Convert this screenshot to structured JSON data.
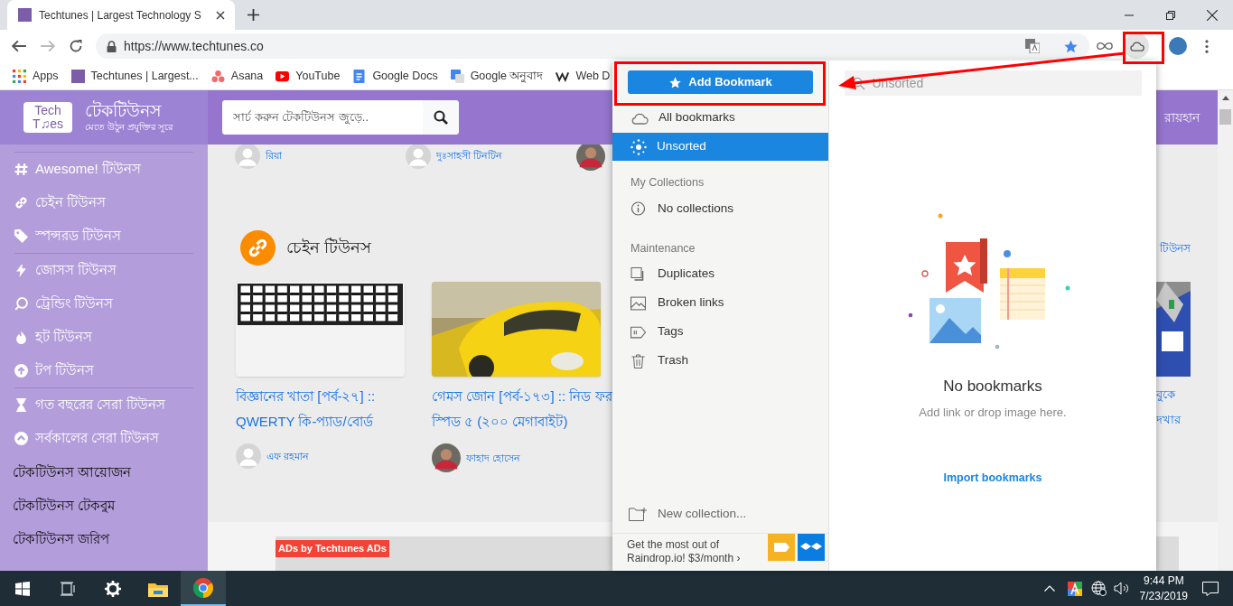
{
  "browser": {
    "tab": {
      "title": "Techtunes | Largest Technology S"
    },
    "url": "https://www.techtunes.co",
    "bookmarks": [
      {
        "label": "Apps"
      },
      {
        "label": "Techtunes | Largest..."
      },
      {
        "label": "Asana"
      },
      {
        "label": "YouTube"
      },
      {
        "label": "Google Docs"
      },
      {
        "label": "Google অনুবাদ"
      },
      {
        "label": "Web D"
      }
    ]
  },
  "site": {
    "logo": {
      "line1": "Tech",
      "line2": "T♫es"
    },
    "brand": "টেকটিউনস",
    "tagline": "মেতে উঠুন প্রযুক্তির সুরে",
    "search": {
      "placeholder": "সার্চ করুন টেকটিউনস জুড়ে.."
    },
    "user": "রায়হান",
    "sidebar": {
      "groups": [
        {
          "divided": true,
          "items": [
            {
              "label": "Awesome! টিউনস",
              "kind": "icon"
            },
            {
              "label": "চেইন টিউনস",
              "kind": "icon"
            },
            {
              "label": "স্পন্সরড টিউনস",
              "kind": "icon"
            }
          ]
        },
        {
          "divided": true,
          "items": [
            {
              "label": "জোসস টিউনস",
              "kind": "icon"
            },
            {
              "label": "ট্রেন্ডিং টিউনস",
              "kind": "icon"
            },
            {
              "label": "হট টিউনস",
              "kind": "icon"
            },
            {
              "label": "টপ টিউনস",
              "kind": "icon"
            }
          ]
        },
        {
          "divided": true,
          "items": [
            {
              "label": "গত বছরের সেরা টিউনস",
              "kind": "icon"
            },
            {
              "label": "সর্বকালের সেরা টিউনস",
              "kind": "icon"
            }
          ]
        },
        {
          "divided": false,
          "items": [
            {
              "label": "টেকটিউনস আয়োজন",
              "kind": "text"
            },
            {
              "label": "টেকটিউনস টেকবুম",
              "kind": "text"
            },
            {
              "label": "টেকটিউনস জরিপ",
              "kind": "text"
            }
          ]
        }
      ]
    },
    "authors": [
      {
        "name": "রিয়া",
        "kind": "silhouette"
      },
      {
        "name": "দুঃসাহসী টিনটিন",
        "kind": "silhouette"
      },
      {
        "kind": "picture"
      }
    ],
    "section": {
      "title": "চেইন টিউনস",
      "more": "টিউনস"
    },
    "cards": [
      {
        "title": "বিজ্ঞানের খাতা [পর্ব-২৭] :: QWERTY কি-প্যাড/বোর্ড",
        "author": "এফ রহমান",
        "kind": "silhouette"
      },
      {
        "title": "গেমস জোন [পর্ব-১৭৩] :: নিড ফর স্পিড ৫ (২০০ মেগাবাইট)",
        "author": "ফাহাদ হোসেন",
        "kind": "picture"
      },
      {
        "title": "বুকে দখার"
      }
    ],
    "ad": {
      "label": "ADs by Techtunes ADs"
    }
  },
  "raindrop": {
    "add_button": "Add Bookmark",
    "search": {
      "placeholder": "Unsorted"
    },
    "nav": [
      {
        "label": "All bookmarks",
        "selected": false
      },
      {
        "label": "Unsorted",
        "selected": true
      }
    ],
    "sections": [
      {
        "title": "My Collections",
        "items": [
          "No collections"
        ]
      },
      {
        "title": "Maintenance",
        "items": [
          "Duplicates",
          "Broken links",
          "Tags",
          "Trash"
        ]
      }
    ],
    "new_collection": "New collection...",
    "promo": "Get the most out of Raindrop.io! $3/month ›",
    "empty": {
      "title": "No bookmarks",
      "hint": "Add link or drop image here.",
      "import": "Import bookmarks"
    }
  },
  "taskbar": {
    "time": "9:44 PM",
    "date": "7/23/2019"
  }
}
